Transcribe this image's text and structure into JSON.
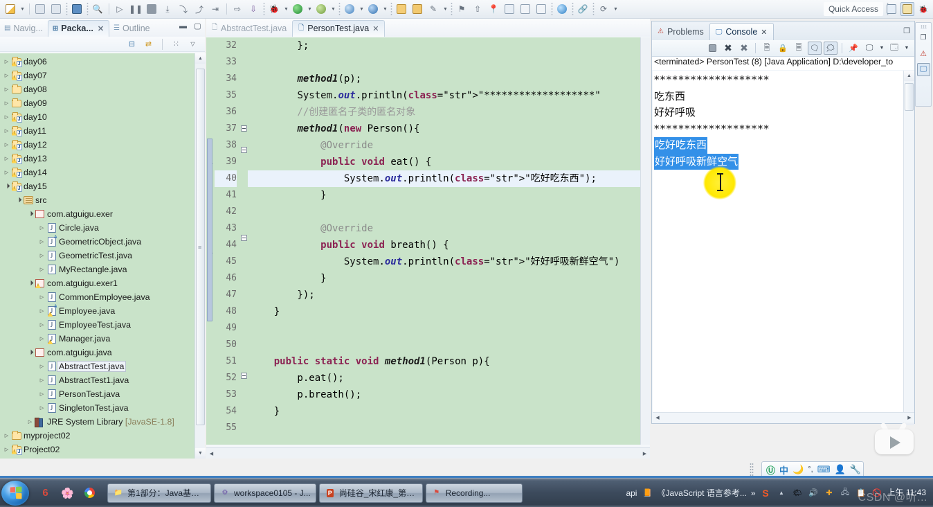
{
  "toolbar": {
    "quick_access": "Quick Access",
    "icons": [
      "new-file-icon",
      "new-dropdown-arrow",
      "save-icon",
      "save-all-icon",
      "print-icon",
      "search-icon",
      "run-last-tool-icon",
      "pause-icon",
      "stop-icon",
      "step-into-icon",
      "step-over-icon",
      "step-return-icon",
      "step-filters-icon",
      "next-annotation-icon",
      "previous-annotation-icon",
      "debug-icon",
      "debug-dropdown-arrow",
      "run-icon",
      "run-dropdown-arrow",
      "coverage-icon",
      "coverage-dropdown-arrow",
      "external-tools-icon",
      "external-tools-arrow",
      "browser-icon",
      "browser-arrow",
      "open-type-icon",
      "open-resource-icon",
      "search-again-icon",
      "search-arrow",
      "tag-icon",
      "upload-icon",
      "pin-icon",
      "new-java-project-icon",
      "new-class-icon",
      "new-package-icon",
      "web-icon",
      "link-icon",
      "sync-icon"
    ],
    "perspective_buttons": [
      "open-perspective-icon",
      "java-perspective-icon",
      "debug-perspective-icon"
    ]
  },
  "left_panel": {
    "tabs": [
      {
        "label": "Navig...",
        "icon": "navigator-icon",
        "active": false,
        "closable": false
      },
      {
        "label": "Packa...",
        "icon": "package-explorer-icon",
        "active": true,
        "closable": true
      },
      {
        "label": "Outline",
        "icon": "outline-icon",
        "active": false,
        "closable": false
      }
    ],
    "panel_buttons": [
      "minimize-icon",
      "maximize-icon"
    ],
    "toolbar_icons": [
      "collapse-all-icon",
      "link-with-editor-icon",
      "focus-on-active-task-icon",
      "view-menu-icon"
    ],
    "tree": [
      {
        "label": "day06",
        "indent": 0,
        "twist": "closed",
        "icon": "java-project-warn-icon"
      },
      {
        "label": "day07",
        "indent": 0,
        "twist": "closed",
        "icon": "java-project-warn-icon"
      },
      {
        "label": "day08",
        "indent": 0,
        "twist": "closed",
        "icon": "project-folder-icon"
      },
      {
        "label": "day09",
        "indent": 0,
        "twist": "closed",
        "icon": "project-folder-icon"
      },
      {
        "label": "day10",
        "indent": 0,
        "twist": "closed",
        "icon": "java-project-warn-icon"
      },
      {
        "label": "day11",
        "indent": 0,
        "twist": "closed",
        "icon": "java-project-warn-icon"
      },
      {
        "label": "day12",
        "indent": 0,
        "twist": "closed",
        "icon": "java-project-warn-icon"
      },
      {
        "label": "day13",
        "indent": 0,
        "twist": "closed",
        "icon": "java-project-warn-icon"
      },
      {
        "label": "day14",
        "indent": 0,
        "twist": "closed",
        "icon": "java-project-warn-icon"
      },
      {
        "label": "day15",
        "indent": 0,
        "twist": "open",
        "icon": "java-project-warn-icon"
      },
      {
        "label": "src",
        "indent": 1,
        "twist": "open",
        "icon": "source-folder-icon"
      },
      {
        "label": "com.atguigu.exer",
        "indent": 2,
        "twist": "open",
        "icon": "package-icon"
      },
      {
        "label": "Circle.java",
        "indent": 3,
        "twist": "closed",
        "icon": "java-file-icon"
      },
      {
        "label": "GeometricObject.java",
        "indent": 3,
        "twist": "closed",
        "icon": "java-abstract-file-icon"
      },
      {
        "label": "GeometricTest.java",
        "indent": 3,
        "twist": "closed",
        "icon": "java-file-icon"
      },
      {
        "label": "MyRectangle.java",
        "indent": 3,
        "twist": "closed",
        "icon": "java-file-icon"
      },
      {
        "label": "com.atguigu.exer1",
        "indent": 2,
        "twist": "open",
        "icon": "package-warn-icon"
      },
      {
        "label": "CommonEmployee.java",
        "indent": 3,
        "twist": "closed",
        "icon": "java-file-icon"
      },
      {
        "label": "Employee.java",
        "indent": 3,
        "twist": "closed",
        "icon": "java-abstract-warn-file-icon"
      },
      {
        "label": "EmployeeTest.java",
        "indent": 3,
        "twist": "closed",
        "icon": "java-file-icon"
      },
      {
        "label": "Manager.java",
        "indent": 3,
        "twist": "closed",
        "icon": "java-warn-file-icon"
      },
      {
        "label": "com.atguigu.java",
        "indent": 2,
        "twist": "open",
        "icon": "package-icon"
      },
      {
        "label": "AbstractTest.java",
        "indent": 3,
        "twist": "closed",
        "icon": "java-file-icon",
        "selected": true
      },
      {
        "label": "AbstractTest1.java",
        "indent": 3,
        "twist": "closed",
        "icon": "java-file-icon"
      },
      {
        "label": "PersonTest.java",
        "indent": 3,
        "twist": "closed",
        "icon": "java-file-icon"
      },
      {
        "label": "SingletonTest.java",
        "indent": 3,
        "twist": "closed",
        "icon": "java-file-icon"
      },
      {
        "label": "JRE System Library",
        "suffix": "[JavaSE-1.8]",
        "indent": 2,
        "twist": "closed",
        "icon": "jre-library-icon"
      },
      {
        "label": "myproject02",
        "indent": 0,
        "twist": "closed",
        "icon": "project-folder-icon"
      },
      {
        "label": "Project02",
        "indent": 0,
        "twist": "closed",
        "icon": "java-project-warn-icon"
      }
    ]
  },
  "editor": {
    "tabs": [
      {
        "label": "AbstractTest.java",
        "icon": "java-file-icon",
        "active": false,
        "closable": false
      },
      {
        "label": "PersonTest.java",
        "icon": "java-file-icon",
        "active": true,
        "closable": true
      }
    ],
    "first_line_number": 32,
    "current_line_number": 40,
    "lines": [
      {
        "n": 32,
        "fold": false,
        "text": "        };"
      },
      {
        "n": 33,
        "fold": false,
        "text": ""
      },
      {
        "n": 34,
        "fold": false,
        "text": "        method1(p);"
      },
      {
        "n": 35,
        "fold": false,
        "text": "        System.out.println(\"*******************\""
      },
      {
        "n": 36,
        "fold": false,
        "text": "        //创建匿名子类的匿名对象"
      },
      {
        "n": 37,
        "fold": true,
        "text": "        method1(new Person(){"
      },
      {
        "n": 38,
        "fold": true,
        "text": "            @Override"
      },
      {
        "n": 39,
        "fold": false,
        "text": "            public void eat() {"
      },
      {
        "n": 40,
        "fold": false,
        "text": "                System.out.println(\"吃好吃东西\");"
      },
      {
        "n": 41,
        "fold": false,
        "text": "            }"
      },
      {
        "n": 42,
        "fold": false,
        "text": ""
      },
      {
        "n": 43,
        "fold": true,
        "text": "            @Override"
      },
      {
        "n": 44,
        "fold": false,
        "text": "            public void breath() {"
      },
      {
        "n": 45,
        "fold": false,
        "text": "                System.out.println(\"好好呼吸新鲜空气\")"
      },
      {
        "n": 46,
        "fold": false,
        "text": "            }"
      },
      {
        "n": 47,
        "fold": false,
        "text": "        });"
      },
      {
        "n": 48,
        "fold": false,
        "text": "    }"
      },
      {
        "n": 49,
        "fold": false,
        "text": ""
      },
      {
        "n": 50,
        "fold": false,
        "text": ""
      },
      {
        "n": 51,
        "fold": true,
        "text": "    public static void method1(Person p){"
      },
      {
        "n": 52,
        "fold": false,
        "text": "        p.eat();"
      },
      {
        "n": 53,
        "fold": false,
        "text": "        p.breath();"
      },
      {
        "n": 54,
        "fold": false,
        "text": "    }"
      },
      {
        "n": 55,
        "fold": false,
        "text": ""
      }
    ]
  },
  "console": {
    "tabs": [
      {
        "label": "Problems",
        "icon": "problems-icon",
        "active": false,
        "closable": false
      },
      {
        "label": "Console",
        "icon": "console-icon",
        "active": true,
        "closable": true
      }
    ],
    "maximize_label": "restore-icon",
    "toolbar_icons": [
      "terminate-icon",
      "remove-launch-icon",
      "remove-all-terminated-icon",
      "clear-console-icon",
      "scroll-lock-icon",
      "word-wrap-icon",
      "show-console-on-output-icon",
      "show-console-on-error-icon",
      "pin-console-icon",
      "display-selected-console-icon",
      "display-console-arrow",
      "open-console-icon",
      "open-console-arrow"
    ],
    "header": "<terminated> PersonTest (8) [Java Application] D:\\developer_to",
    "output": [
      {
        "text": "*******************",
        "highlighted": false
      },
      {
        "text": "吃东西",
        "highlighted": false
      },
      {
        "text": "好好呼吸",
        "highlighted": false
      },
      {
        "text": "*******************",
        "highlighted": false
      },
      {
        "text": "吃好吃东西",
        "highlighted": true
      },
      {
        "text": "好好呼吸新鲜空气",
        "highlighted": true
      }
    ],
    "selection_color": "#3390e8",
    "cursor": "i-beam-cursor"
  },
  "right_dock": {
    "icons": [
      "restore-view-icon",
      "problems-view-icon",
      "console-view-icon"
    ]
  },
  "ime": {
    "icons": [
      "sogou-logo-icon",
      "chinese-mode-icon",
      "moon-icon",
      "halfwidth-punct-icon",
      "soft-keyboard-icon",
      "user-icon",
      "tools-icon"
    ],
    "mode_label": "中"
  },
  "taskbar": {
    "start_label": "start-orb",
    "quick_launch": [
      "360-browser-icon",
      "firefox-icon",
      "chrome-icon"
    ],
    "tasks": [
      {
        "label": "第1部分：Java基础...",
        "icon": "folder-icon"
      },
      {
        "label": "workspace0105 - J...",
        "icon": "eclipse-icon"
      },
      {
        "label": "尚硅谷_宋红康_第6...",
        "icon": "powerpoint-icon"
      },
      {
        "label": "Recording...",
        "icon": "recording-icon"
      }
    ],
    "tray_text_left": "api",
    "tray_doc_label": "《JavaScript 语言参考...",
    "tray_overflow": "»",
    "tray_icons": [
      "sogou-s-icon",
      "show-hidden-arrow",
      "weather-icon",
      "volume-icon",
      "security-icon",
      "network-icon",
      "clipboard-icon",
      "block-icon"
    ],
    "clock": "上午 11:43",
    "watermark": "CSDN @听..."
  }
}
